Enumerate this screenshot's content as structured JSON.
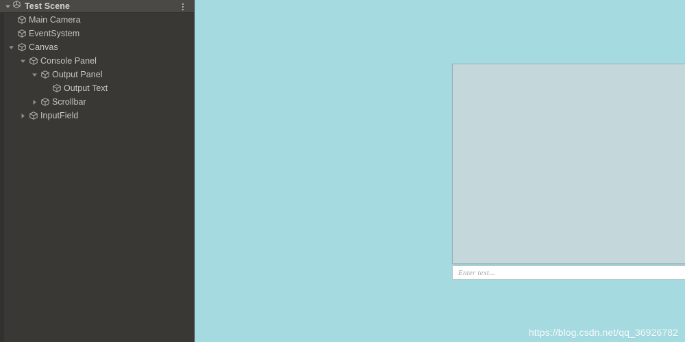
{
  "hierarchy": {
    "header": {
      "title": "Test Scene",
      "scene_icon": "unity-scene-icon",
      "foldout": "expanded",
      "menu_icon": "kebab-menu-icon"
    },
    "items": [
      {
        "label": "Main Camera",
        "depth": 1,
        "foldout": "none",
        "icon": "gameobject-cube-icon"
      },
      {
        "label": "EventSystem",
        "depth": 1,
        "foldout": "none",
        "icon": "gameobject-cube-icon"
      },
      {
        "label": "Canvas",
        "depth": 1,
        "foldout": "expanded",
        "icon": "gameobject-cube-icon"
      },
      {
        "label": "Console Panel",
        "depth": 2,
        "foldout": "expanded",
        "icon": "gameobject-cube-icon"
      },
      {
        "label": "Output Panel",
        "depth": 3,
        "foldout": "expanded",
        "icon": "gameobject-cube-icon"
      },
      {
        "label": "Output Text",
        "depth": 4,
        "foldout": "none",
        "icon": "gameobject-cube-icon"
      },
      {
        "label": "Scrollbar",
        "depth": 3,
        "foldout": "collapsed",
        "icon": "gameobject-cube-icon"
      },
      {
        "label": "InputField",
        "depth": 2,
        "foldout": "collapsed",
        "icon": "gameobject-cube-icon"
      }
    ]
  },
  "game_view": {
    "background_color": "#a5dbe0",
    "console": {
      "output_panel": {
        "fill_color": "#c4d8dc",
        "border_color": "#9bb0b4",
        "text": ""
      },
      "scrollbar": {
        "track_color": "#f4f4f3",
        "orientation": "vertical"
      },
      "input_field": {
        "value": "",
        "placeholder": "Enter text..."
      }
    }
  },
  "watermark": {
    "text": "https://blog.csdn.net/qq_36926782"
  }
}
